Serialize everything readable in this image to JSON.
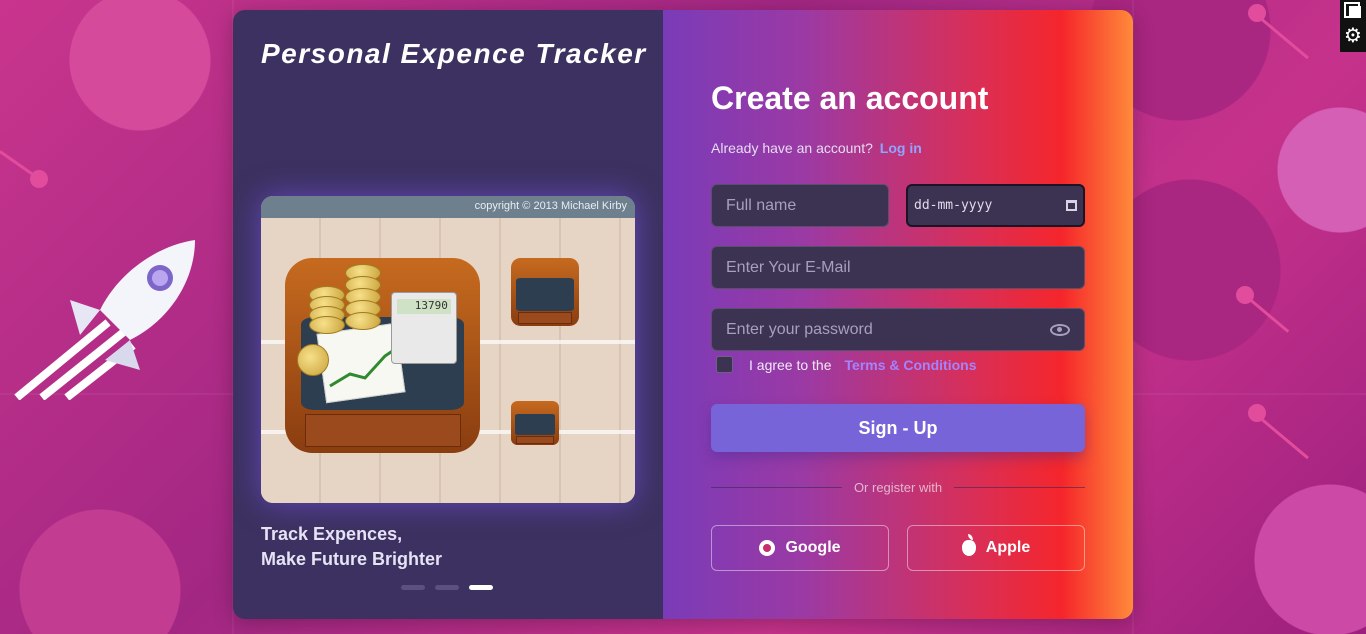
{
  "brand": {
    "title": "Personal Expence Tracker"
  },
  "hero": {
    "copyright": "copyright © 2013 Michael Kirby",
    "calculator_display": "13790",
    "tagline_line1": "Track Expences,",
    "tagline_line2": "Make Future Brighter",
    "carousel": {
      "count": 3,
      "active_index": 2
    }
  },
  "form": {
    "title": "Create an account",
    "login_prompt": "Already have an account?",
    "login_link": "Log in",
    "full_name_placeholder": "Full name",
    "date_placeholder": "dd-mm-yyyy",
    "email_placeholder": "Enter Your E-Mail",
    "password_placeholder": "Enter your password",
    "agree_text": "I agree to the",
    "terms_link": "Terms & Conditions",
    "signup_label": "Sign - Up",
    "divider_text": "Or register with",
    "google_label": "Google",
    "apple_label": "Apple"
  },
  "colors": {
    "left_panel": "#3c3160",
    "accent_button": "#7764d8",
    "link": "#8fa4ff",
    "terms": "#a384ff"
  }
}
